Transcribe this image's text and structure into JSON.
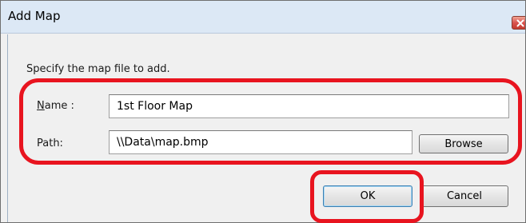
{
  "dialog": {
    "title": "Add Map",
    "instruction": "Specify the map file to add.",
    "name_label": "Name :",
    "name_value": "1st Floor Map",
    "path_label": "Path:",
    "path_value": "\\\\Data\\map.bmp",
    "browse_label": "Browse",
    "ok_label": "OK",
    "cancel_label": "Cancel"
  },
  "colors": {
    "annotation": "#e8141f",
    "titlebar": "#dce8f5",
    "client_background": "#f0f0f0",
    "close_button": "#d9534f"
  },
  "icons": {
    "close": "close-icon"
  }
}
